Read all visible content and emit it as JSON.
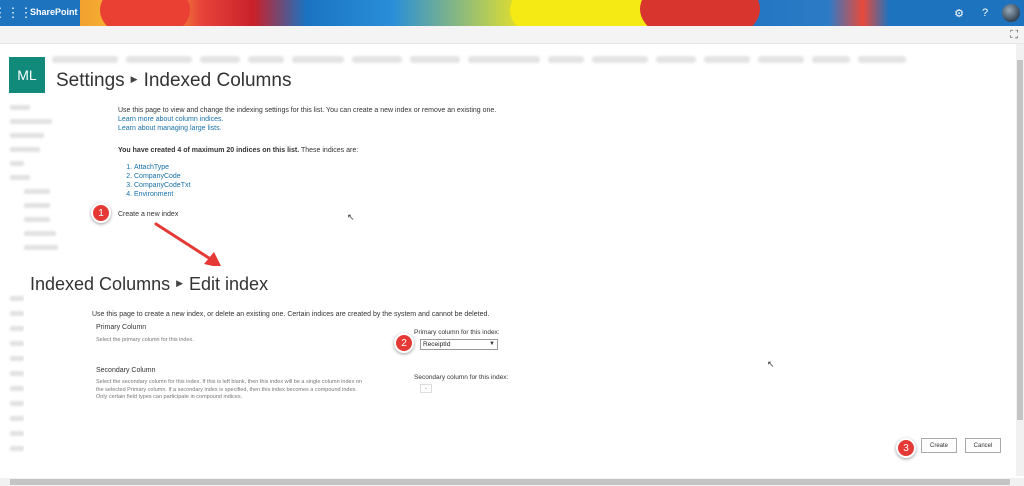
{
  "suitebar": {
    "brand": "SharePoint",
    "waffle_icon": "waffle-icon",
    "settings_icon": "gear-icon",
    "help_icon": "help-icon"
  },
  "site": {
    "logo_initials": "ML",
    "breadcrumb_root": "Settings",
    "breadcrumb_current": "Indexed Columns"
  },
  "indexed_columns": {
    "intro": "Use this page to view and change the indexing settings for this list. You can create a new index or remove an existing one.",
    "links": [
      "Learn more about column indices.",
      "Learn about managing large lists."
    ],
    "count_bold": "You have created 4 of maximum 20 indices on this list.",
    "count_rest": " These indices are:",
    "indices": [
      "AttachType",
      "CompanyCode",
      "CompanyCodeTxt",
      "Environment"
    ],
    "create_link": "Create a new index"
  },
  "edit_index": {
    "breadcrumb_root": "Indexed Columns",
    "breadcrumb_current": "Edit index",
    "description": "Use this page to create a new index, or delete an existing one. Certain indices are created by the system and cannot be deleted.",
    "primary_title": "Primary Column",
    "primary_desc": "Select the primary column for this index.",
    "primary_label": "Primary column for this index:",
    "primary_value": "ReceiptId",
    "secondary_title": "Secondary Column",
    "secondary_desc": "Select the secondary column for this index. If this is left blank, then this index will be a single column index on the selected Primary column. If a secondary index is specified, then this index becomes a compound index. Only certain field types can participate in compound indices.",
    "secondary_label": "Secondary column for this index:",
    "create_button": "Create",
    "cancel_button": "Cancel"
  },
  "callouts": [
    "1",
    "2",
    "3"
  ],
  "colors": {
    "suitebar": "#1e73be",
    "logo": "#128a7b",
    "link": "#1670a8",
    "callout": "#e53935"
  }
}
